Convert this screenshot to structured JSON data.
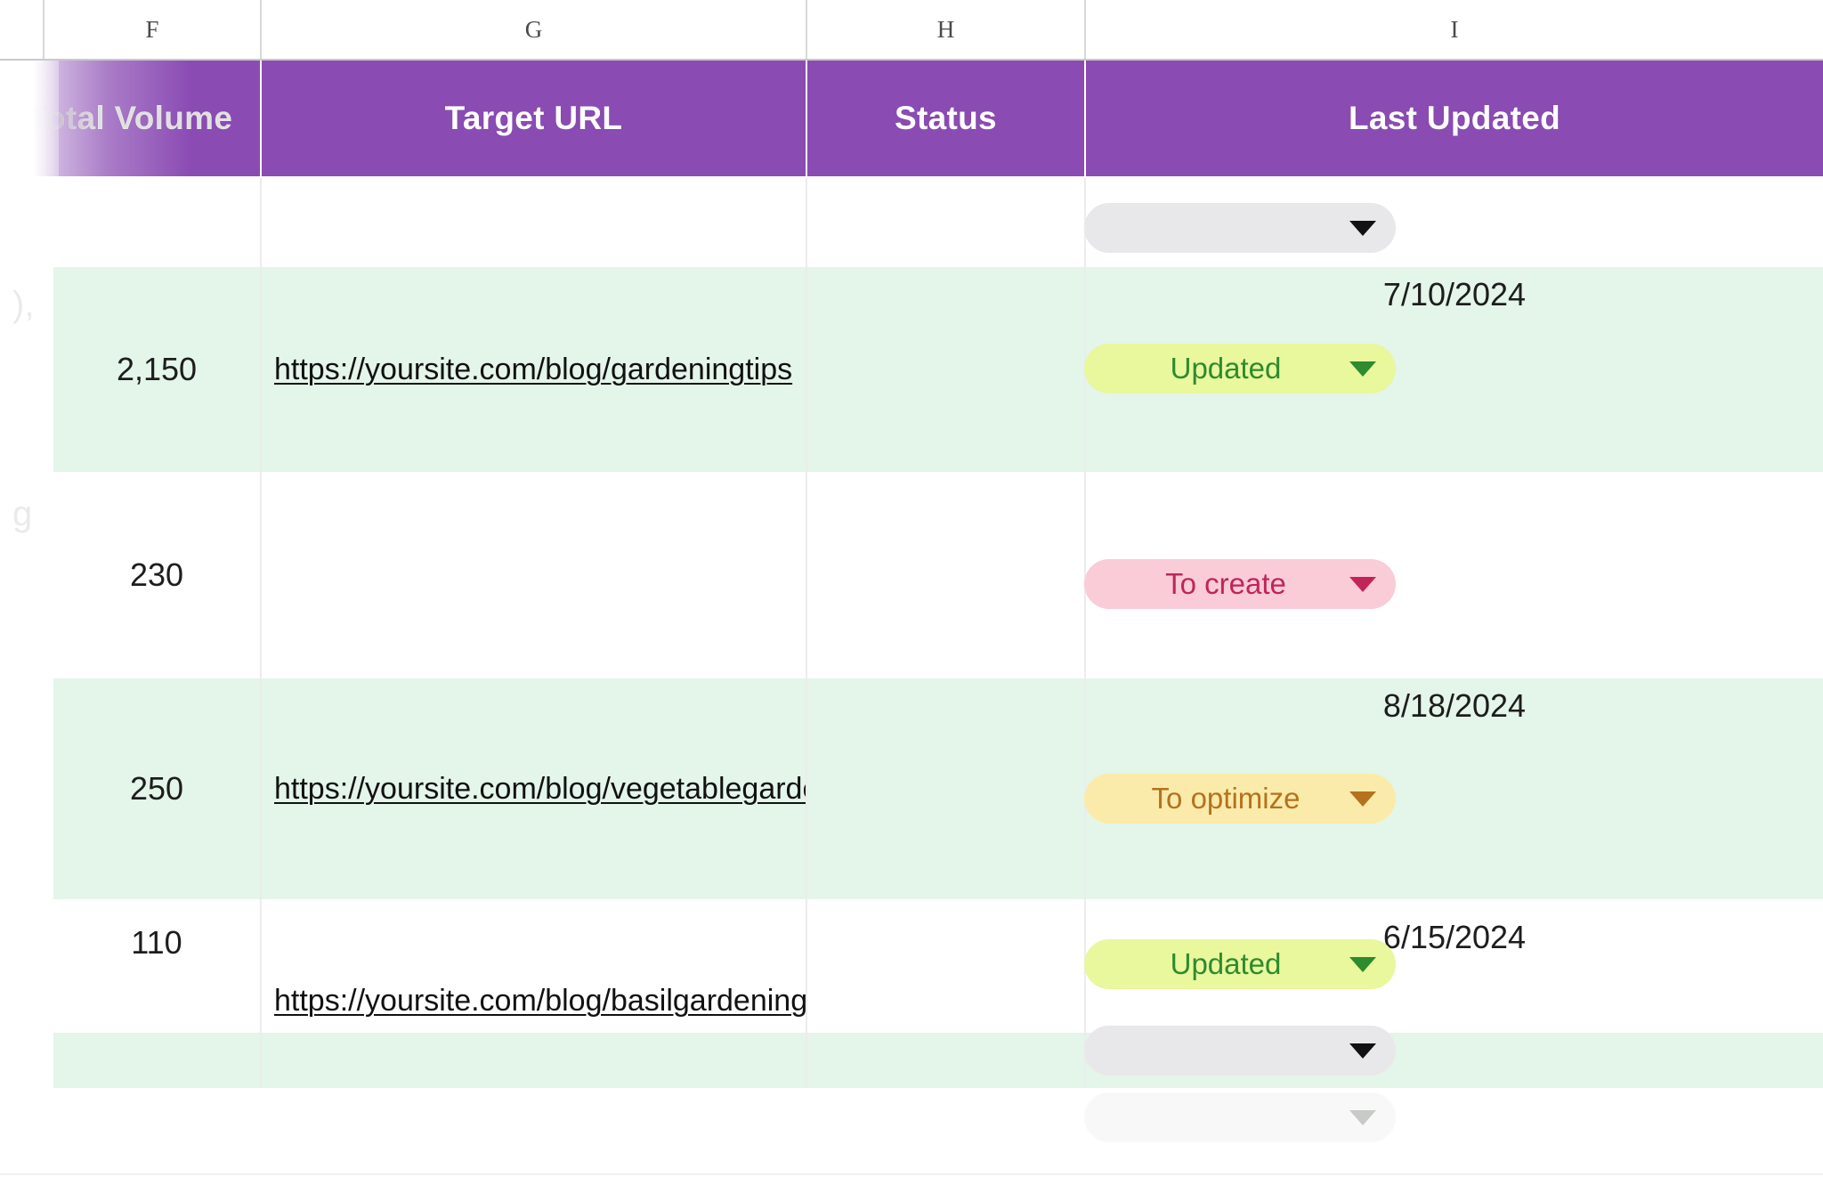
{
  "spreadsheet": {
    "column_letters": [
      "F",
      "G",
      "H",
      "I"
    ],
    "headers": [
      "Total Volume",
      "Target URL",
      "Status",
      "Last Updated"
    ],
    "header_bg": "#8a4bb3",
    "header_text_color": "#ffffff",
    "row_band_color": "#e4f5ea",
    "ghost_text": {
      "top": "),",
      "bottom": "g"
    },
    "status_options": {
      "updated": {
        "label": "Updated",
        "bg": "#e9f79d",
        "color": "#2e8b2e"
      },
      "to_create": {
        "label": "To create",
        "bg": "#f9ccd8",
        "color": "#c2245a"
      },
      "to_optimize": {
        "label": "To optimize",
        "bg": "#fbebaa",
        "color": "#b4721f"
      },
      "blank": {
        "label": "",
        "bg": "#e8e8eb",
        "color": "#111111"
      }
    },
    "rows": [
      {
        "total_volume": "",
        "target_url": "",
        "status": "",
        "last_updated": ""
      },
      {
        "total_volume": "2,150",
        "target_url": "https://yoursite.com/blog/gardeningtips",
        "status": "Updated",
        "last_updated": "7/10/2024"
      },
      {
        "total_volume": "230",
        "target_url": "",
        "status": "To create",
        "last_updated": ""
      },
      {
        "total_volume": "250",
        "target_url": "https://yoursite.com/blog/vegetablegardening",
        "status": "To optimize",
        "last_updated": "8/18/2024"
      },
      {
        "total_volume": "110",
        "target_url": "https://yoursite.com/blog/basilgardening",
        "status": "Updated",
        "last_updated": "6/15/2024"
      },
      {
        "total_volume": "",
        "target_url": "",
        "status": "",
        "last_updated": ""
      },
      {
        "total_volume": "",
        "target_url": "",
        "status": "",
        "last_updated": ""
      }
    ]
  }
}
